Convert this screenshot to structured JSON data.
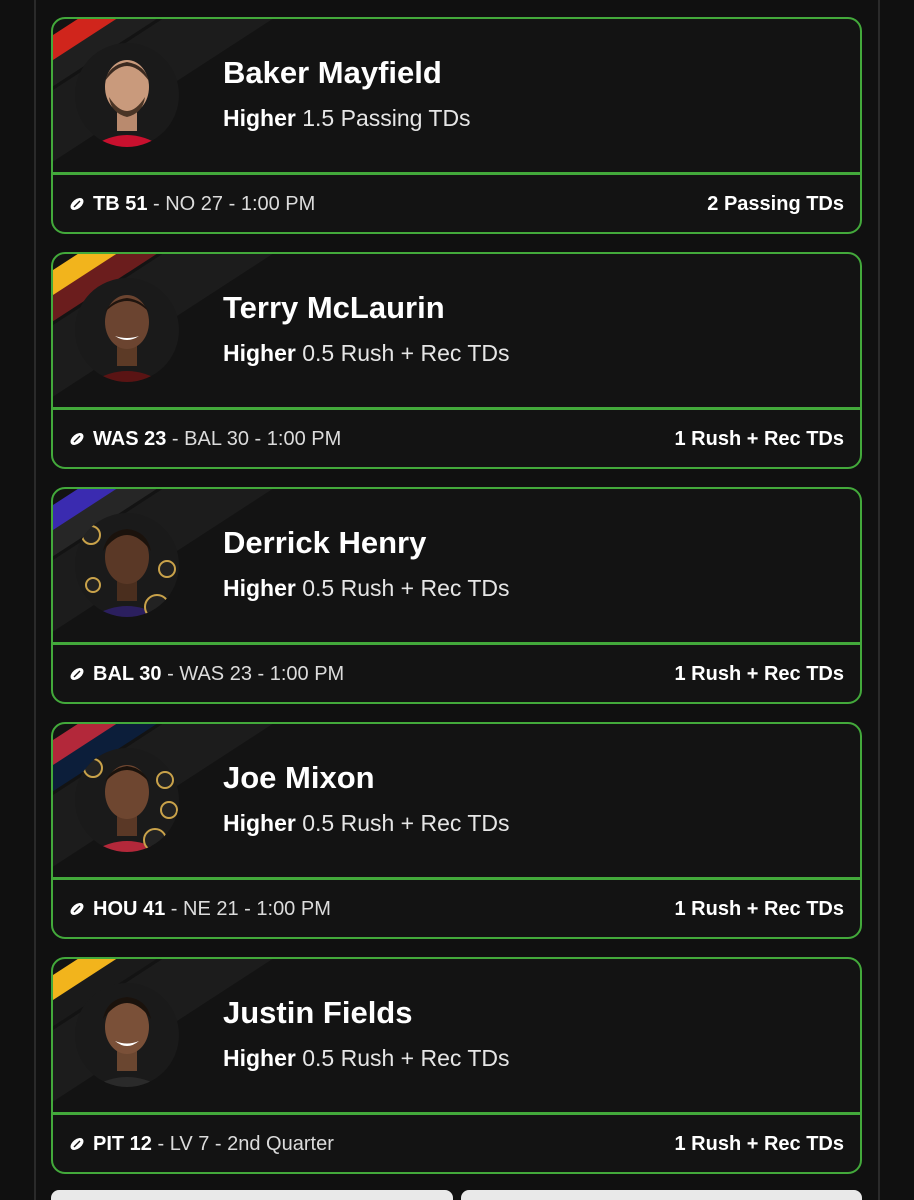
{
  "picks": [
    {
      "player": "Baker Mayfield",
      "direction": "Higher",
      "line": "1.5 Passing TDs",
      "team": "TB 51",
      "game_rest": " - NO 27 - 1:00 PM",
      "result": "2 Passing TDs",
      "colors": {
        "stripe_a": "#d0251c",
        "stripe_b": "#1f1f1f",
        "jersey": "#c8102e"
      }
    },
    {
      "player": "Terry McLaurin",
      "direction": "Higher",
      "line": "0.5 Rush + Rec TDs",
      "team": "WAS 23",
      "game_rest": " - BAL 30 - 1:00 PM",
      "result": "1 Rush + Rec TDs",
      "colors": {
        "stripe_a": "#f2b41c",
        "stripe_b": "#6b1d1d",
        "jersey": "#5a1414"
      }
    },
    {
      "player": "Derrick Henry",
      "direction": "Higher",
      "line": "0.5 Rush + Rec TDs",
      "team": "BAL 30",
      "game_rest": " - WAS 23 - 1:00 PM",
      "result": "1 Rush + Rec TDs",
      "colors": {
        "stripe_a": "#3a2bb0",
        "stripe_b": "#262626",
        "jersey": "#2b1f5e"
      }
    },
    {
      "player": "Joe Mixon",
      "direction": "Higher",
      "line": "0.5 Rush + Rec TDs",
      "team": "HOU 41",
      "game_rest": " - NE 21 - 1:00 PM",
      "result": "1 Rush + Rec TDs",
      "colors": {
        "stripe_a": "#b3283a",
        "stripe_b": "#0c1e3a",
        "jersey": "#b3283a"
      }
    },
    {
      "player": "Justin Fields",
      "direction": "Higher",
      "line": "0.5 Rush + Rec TDs",
      "team": "PIT 12",
      "game_rest": " - LV 7 - 2nd Quarter",
      "result": "1 Rush + Rec TDs",
      "colors": {
        "stripe_a": "#f2b41c",
        "stripe_b": "#1a1a1a",
        "jersey": "#1a1a1a"
      }
    }
  ],
  "icons": {
    "football": "football-icon",
    "avatar": "player-avatar"
  },
  "accent": "#43a93b"
}
